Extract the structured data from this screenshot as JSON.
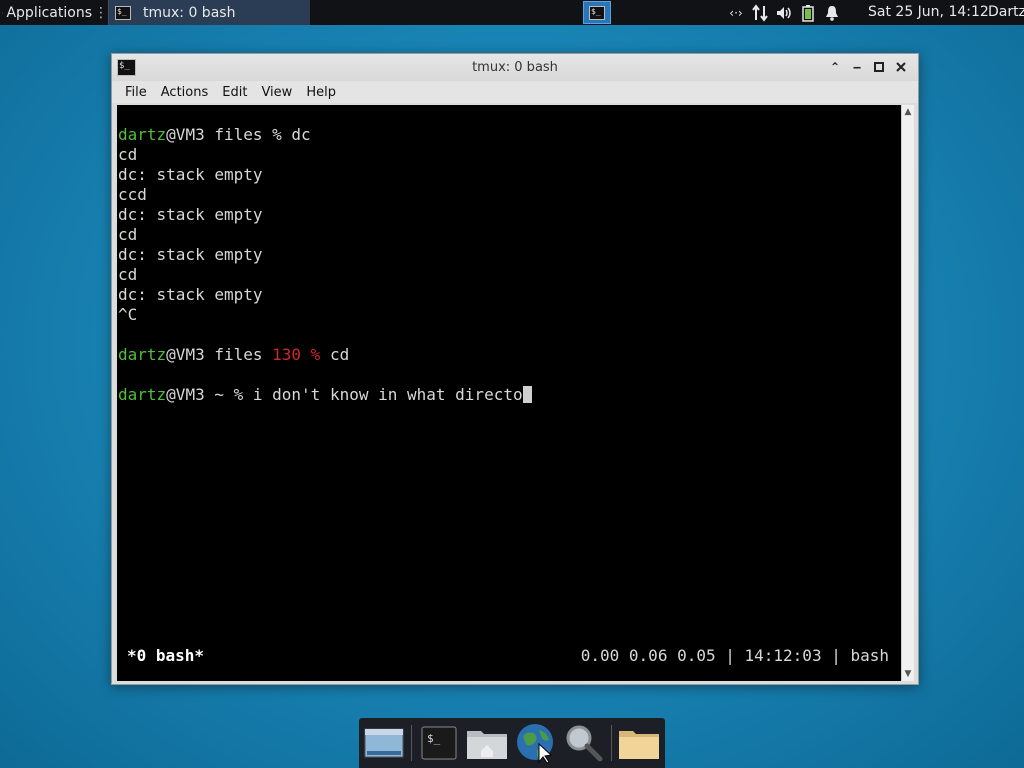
{
  "top_panel": {
    "applications_label": "Applications",
    "task_title": "tmux: 0 bash",
    "clock": "Sat 25 Jun, 14:12",
    "user": "Dartz",
    "tray_icons": [
      "network-icon",
      "transfer-icon",
      "volume-icon",
      "battery-icon",
      "notification-icon"
    ]
  },
  "window": {
    "title": "tmux: 0 bash",
    "menu": [
      "File",
      "Actions",
      "Edit",
      "View",
      "Help"
    ]
  },
  "terminal": {
    "lines": [
      {
        "user": "dartz",
        "host": "@VM3 files ",
        "code": "",
        "rest": "% dc"
      },
      {
        "text": "cd"
      },
      {
        "text": "dc: stack empty"
      },
      {
        "text": "ccd"
      },
      {
        "text": "dc: stack empty"
      },
      {
        "text": "cd"
      },
      {
        "text": "dc: stack empty"
      },
      {
        "text": "cd"
      },
      {
        "text": "dc: stack empty"
      },
      {
        "text": "^C"
      },
      {
        "user": "dartz",
        "host": "@VM3 files ",
        "code": "130 ",
        "rest": "% cd"
      },
      {
        "user": "dartz",
        "host": "@VM3 ~ ",
        "code": "",
        "rest": "% i don't know in what directo"
      }
    ],
    "status_left": "*0 bash*",
    "status_right": "0.00 0.06 0.05 | 14:12:03 | bash"
  },
  "dock": [
    "show-desktop-icon",
    "terminal-icon",
    "home-folder-icon",
    "web-browser-icon",
    "search-icon",
    "files-folder-icon"
  ]
}
